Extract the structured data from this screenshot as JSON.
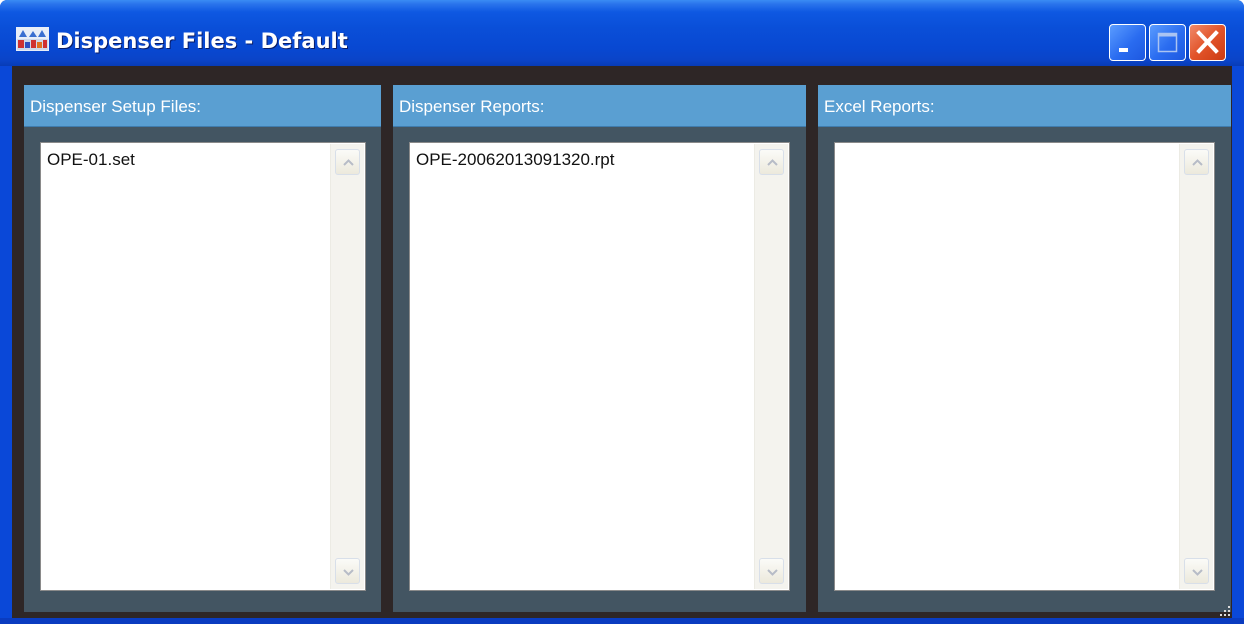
{
  "window": {
    "title": "Dispenser Files - Default",
    "icon": "app-icon",
    "controls": {
      "minimize_icon": "minimize-icon",
      "maximize_icon": "maximize-icon",
      "close_icon": "close-icon"
    }
  },
  "panels": [
    {
      "header": "Dispenser Setup Files:",
      "items": [
        "OPE-01.set"
      ]
    },
    {
      "header": "Dispenser Reports:",
      "items": [
        "OPE-20062013091320.rpt"
      ]
    },
    {
      "header": "Excel Reports:",
      "items": []
    }
  ],
  "colors": {
    "titlebar": "#0a4fd8",
    "client_background": "#2e2626",
    "panel_background": "#435562",
    "panel_header": "#5a9fd2",
    "close_button": "#e2542a"
  }
}
